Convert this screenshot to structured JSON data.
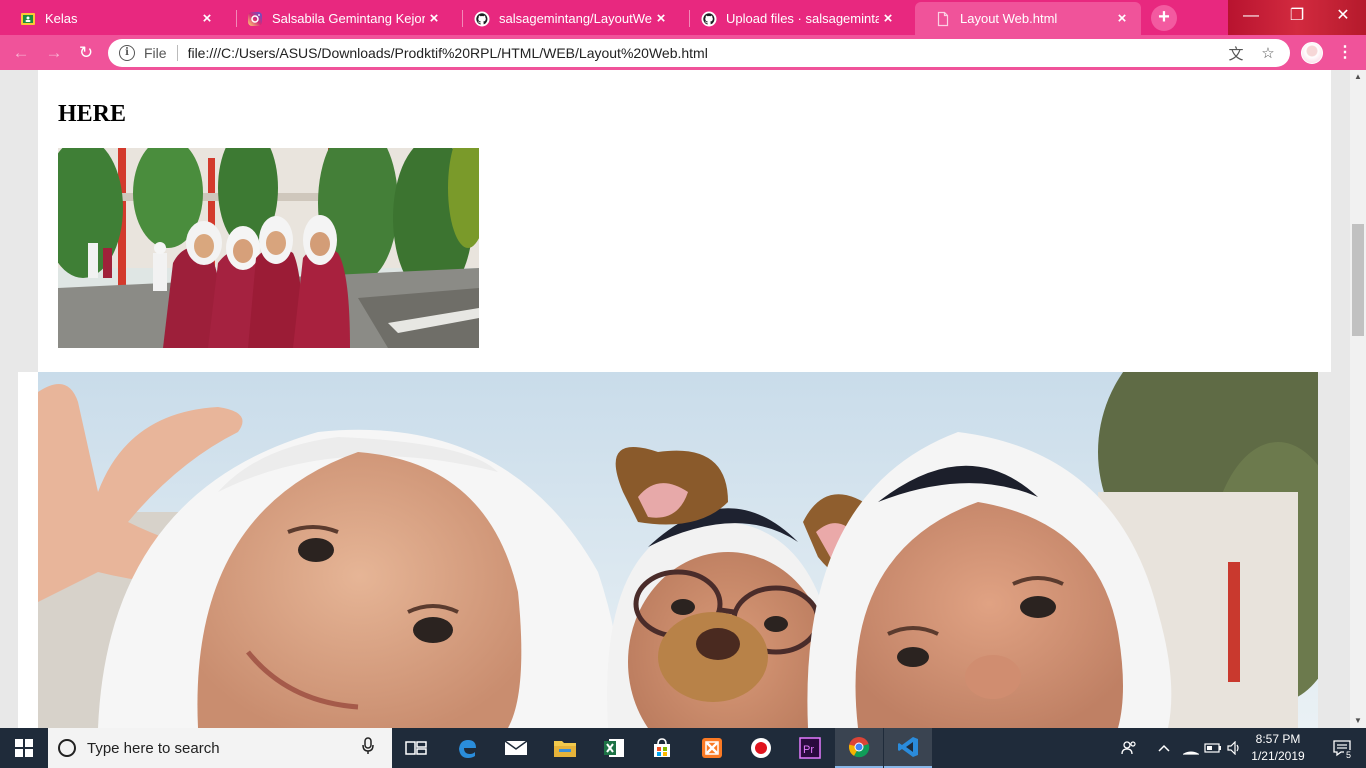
{
  "browser": {
    "tabs": [
      {
        "title": "Kelas",
        "favicon": "google-classroom-icon",
        "active": false
      },
      {
        "title": "Salsabila Gemintang Kejora (@",
        "favicon": "instagram-icon",
        "active": false
      },
      {
        "title": "salsagemintang/LayoutWebPr",
        "favicon": "github-icon",
        "active": false
      },
      {
        "title": "Upload files · salsagemintang/L",
        "favicon": "github-icon",
        "active": false
      },
      {
        "title": "Layout Web.html",
        "favicon": "file-icon",
        "active": true
      }
    ],
    "tab_close_glyph": "×",
    "new_tab_glyph": "+",
    "window_controls": {
      "minimize": "—",
      "restore": "❐",
      "close": "✕"
    },
    "toolbar": {
      "back_glyph": "←",
      "forward_glyph": "→",
      "reload_glyph": "↻",
      "info_glyph": "i",
      "scheme_label": "File",
      "url": "file:///C:/Users/ASUS/Downloads/Prodktif%20RPL/HTML/WEB/Layout%20Web.html",
      "translate_glyph": "文",
      "bookmark_glyph": "☆",
      "menu_glyph": "⋮"
    },
    "accent_color": "#e8287f"
  },
  "page": {
    "heading": "HERE",
    "image_small": "group-photo-students-red-blazers",
    "image_large": "selfie-three-girls-white-hijabs-dog-filter"
  },
  "taskbar": {
    "search_placeholder": "Type here to search",
    "apps": [
      "task-view-icon",
      "edge-icon",
      "mail-icon",
      "file-explorer-icon",
      "excel-icon",
      "store-icon",
      "xampp-icon",
      "recorder-icon",
      "premiere-icon",
      "chrome-icon",
      "vscode-icon"
    ],
    "clock_time": "8:57 PM",
    "clock_date": "1/21/2019",
    "notification_count": "5"
  }
}
